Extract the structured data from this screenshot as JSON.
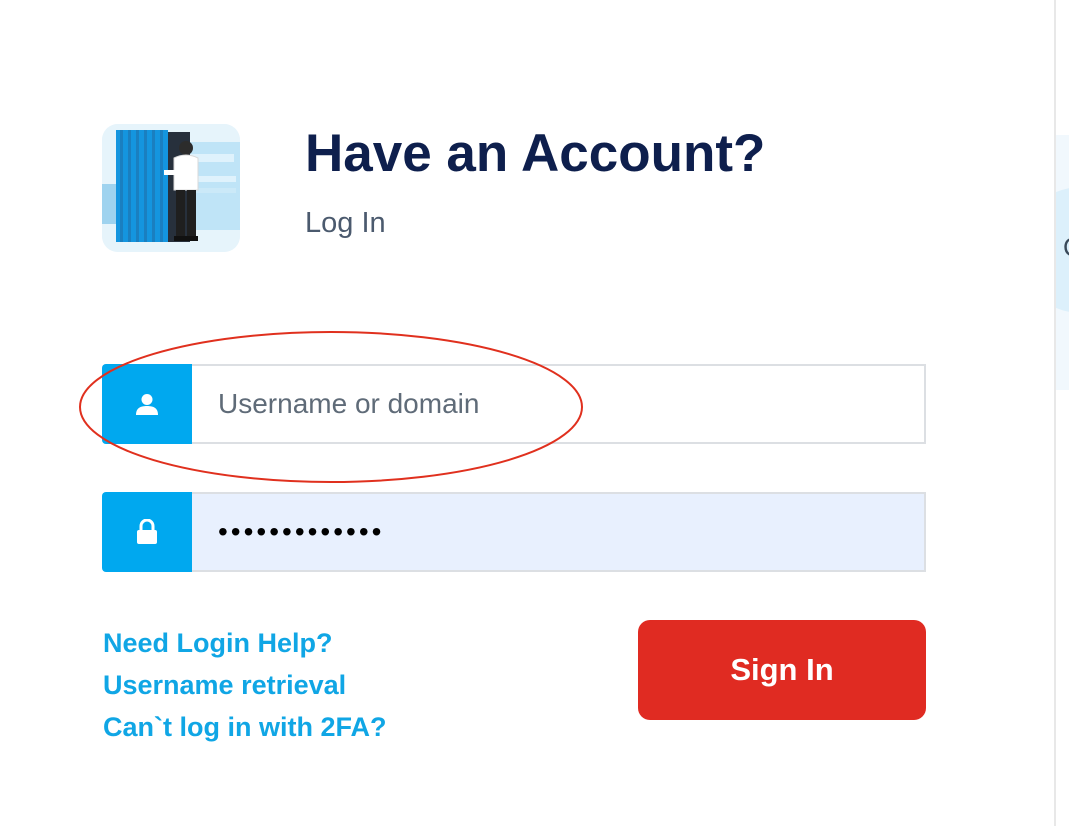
{
  "header": {
    "title": "Have an Account?",
    "subtitle": "Log In"
  },
  "username": {
    "placeholder": "Username or domain",
    "value": "",
    "icon": "user-icon"
  },
  "password": {
    "value": "•••••••••••••",
    "icon": "lock-icon"
  },
  "links": [
    "Need Login Help?",
    "Username retrieval",
    "Can`t log in with 2FA?"
  ],
  "signin_label": "Sign In",
  "side_panel": {
    "bubble_text": "C"
  },
  "colors": {
    "accent": "#00a8ef",
    "title": "#0e1f4d",
    "link": "#10a6e5",
    "button": "#e02b22",
    "annotation": "#e0301e"
  }
}
